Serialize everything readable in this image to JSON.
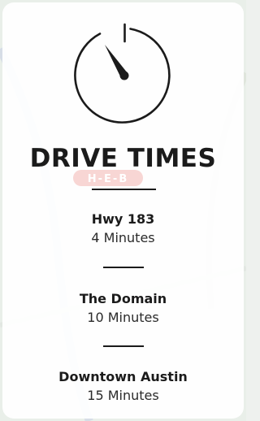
{
  "colors": {
    "text": "#1b1b1b",
    "card": "#ffffff",
    "watermark": "#f3b5b0"
  },
  "icon": "stopwatch-icon",
  "heading": "DRIVE TIMES",
  "watermark_logo": "H-E-B",
  "destinations": [
    {
      "name": "Hwy 183",
      "time": "4 Minutes"
    },
    {
      "name": "The Domain",
      "time": "10 Minutes"
    },
    {
      "name": "Downtown Austin",
      "time": "15 Minutes"
    }
  ]
}
